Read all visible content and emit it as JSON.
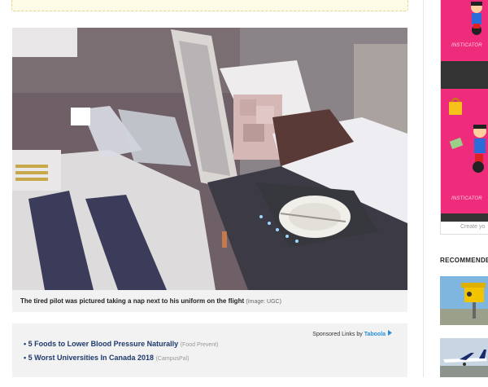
{
  "caption": {
    "text": "The tired pilot was pictured taking a nap next to his uniform on the flight",
    "credit": "(Image: UGC)"
  },
  "sponsored": {
    "label": "Sponsored Links by",
    "brand": "Taboola"
  },
  "ads": [
    {
      "title": "5 Foods to Lower Blood Pressure Naturally",
      "source": "(Food Prevent)"
    },
    {
      "title": "5 Worst Universities In Canada 2018",
      "source": "(CampusPal)"
    }
  ],
  "sidebar": {
    "ad_brand": "INSTICATOR",
    "create_label": "Create yo",
    "recommended_title": "RECOMMENDE"
  },
  "colors": {
    "accent_pink": "#ef2c7c",
    "link_blue": "#1d3a6e",
    "taboola_blue": "#2a8fd8"
  }
}
